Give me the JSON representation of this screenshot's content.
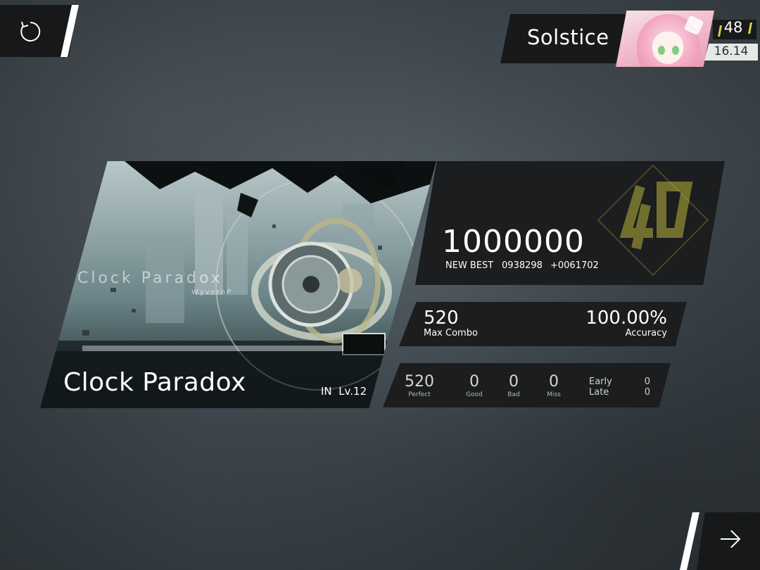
{
  "player": {
    "name": "Solstice",
    "level": "48",
    "rks": "16.14",
    "avatar_icon": "player-avatar"
  },
  "buttons": {
    "retry_icon": "retry-icon",
    "next_icon": "arrow-right-icon"
  },
  "song": {
    "title": "Clock Paradox",
    "difficulty": "IN",
    "level": "Lv.12",
    "art_title": "Clock Paradox",
    "art_artist": "WyvernP"
  },
  "score": {
    "value": "1000000",
    "new_best_label": "NEW BEST",
    "previous_best": "0938298",
    "delta": "+0061702",
    "rank_icon": "phi-rank-icon",
    "rank_color": "#c8c23a"
  },
  "stats": {
    "max_combo": "520",
    "max_combo_label": "Max Combo",
    "accuracy": "100.00%",
    "accuracy_label": "Accuracy"
  },
  "judgement": {
    "perfect": "520",
    "perfect_label": "Perfect",
    "good": "0",
    "good_label": "Good",
    "bad": "0",
    "bad_label": "Bad",
    "miss": "0",
    "miss_label": "Miss",
    "early_label": "Early",
    "early": "0",
    "late_label": "Late",
    "late": "0"
  },
  "colors": {
    "panel": "#1b1d1e",
    "accent": "#d8d24a"
  }
}
